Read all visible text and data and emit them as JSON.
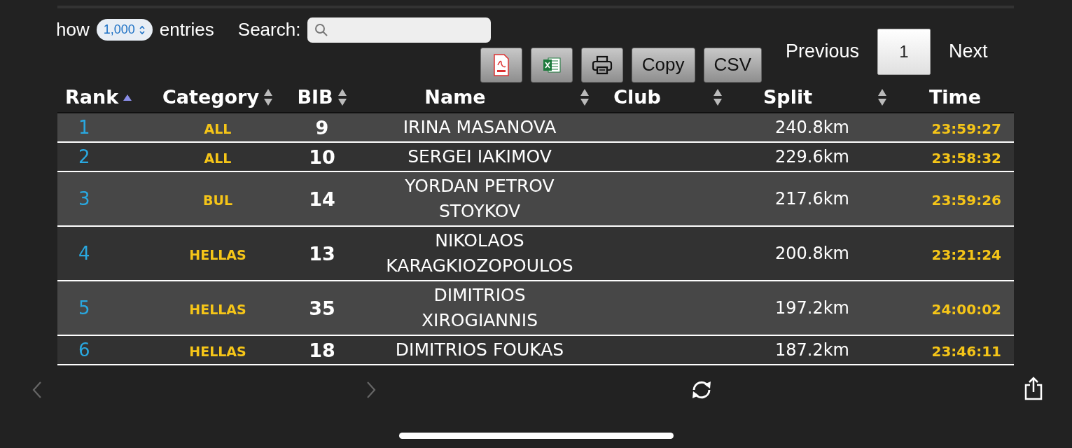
{
  "length_control": {
    "before": "how",
    "value": "1,000",
    "after": "entries"
  },
  "search": {
    "label": "Search:"
  },
  "export_buttons": [
    {
      "kind": "pdf"
    },
    {
      "kind": "excel"
    },
    {
      "kind": "print"
    },
    {
      "kind": "text",
      "label": "Copy"
    },
    {
      "kind": "text",
      "label": "CSV"
    }
  ],
  "pagination": {
    "previous": "Previous",
    "next": "Next",
    "pages": [
      {
        "label": "1",
        "selected": true
      }
    ]
  },
  "table": {
    "columns": [
      {
        "label": "Rank",
        "sortable": true,
        "sorted_ascending": true
      },
      {
        "label": "Category",
        "sortable": true,
        "sorted_ascending": false
      },
      {
        "label": "BIB",
        "sortable": true,
        "sorted_ascending": false
      },
      {
        "label": "Name",
        "sortable": true,
        "sorted_ascending": false
      },
      {
        "label": "Club",
        "sortable": true,
        "sorted_ascending": false
      },
      {
        "label": "Split",
        "sortable": true,
        "sorted_ascending": false
      },
      {
        "label": "Time",
        "sortable": false
      }
    ],
    "rows": [
      {
        "rank": "1",
        "category": "ALL",
        "bib": "9",
        "name": "IRINA MASANOVA",
        "split": "240.8km",
        "time": "23:59:27"
      },
      {
        "rank": "2",
        "category": "ALL",
        "bib": "10",
        "name": "SERGEI IAKIMOV",
        "split": "229.6km",
        "time": "23:58:32"
      },
      {
        "rank": "3",
        "category": "BUL",
        "bib": "14",
        "name": "YORDAN PETROV STOYKOV",
        "split": "217.6km",
        "time": "23:59:26"
      },
      {
        "rank": "4",
        "category": "HELLAS",
        "bib": "13",
        "name": "NIKOLAOS KARAGKIOZOPOULOS",
        "split": "200.8km",
        "time": "23:21:24"
      },
      {
        "rank": "5",
        "category": "HELLAS",
        "bib": "35",
        "name": "DIMITRIOS XIROGIANNIS",
        "split": "197.2km",
        "time": "24:00:02"
      },
      {
        "rank": "6",
        "category": "HELLAS",
        "bib": "18",
        "name": "DIMITRIOS FOUKAS",
        "split": "187.2km",
        "time": "23:46:11"
      }
    ]
  },
  "browser_toolbar": {
    "back_disabled": true,
    "forward_disabled": true
  }
}
